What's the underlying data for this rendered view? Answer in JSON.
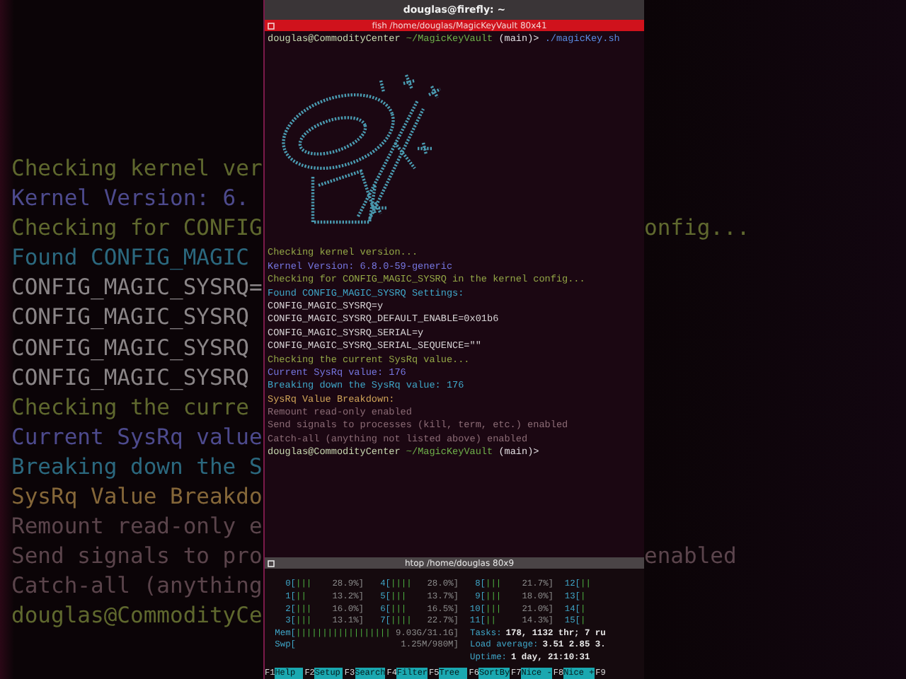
{
  "background_lines": [
    {
      "kind": "check",
      "left": "Checking kernel ver"
    },
    {
      "kind": "version",
      "left": "Kernel Version: 6."
    },
    {
      "kind": "check",
      "left": "Checking for CONFIG",
      "right": "onfig..."
    },
    {
      "kind": "found",
      "left": "Found CONFIG_MAGIC"
    },
    {
      "kind": "plain",
      "left": "CONFIG_MAGIC_SYSRQ="
    },
    {
      "kind": "plain",
      "left": "CONFIG_MAGIC_SYSRQ"
    },
    {
      "kind": "plain",
      "left": "CONFIG_MAGIC_SYSRQ"
    },
    {
      "kind": "plain",
      "left": "CONFIG_MAGIC_SYSRQ"
    },
    {
      "kind": "check",
      "left": "Checking the curre"
    },
    {
      "kind": "version",
      "left": "Current SysRq value"
    },
    {
      "kind": "found",
      "left": "Breaking down the S"
    },
    {
      "kind": "heading",
      "left": "SysRq Value Breakdo"
    },
    {
      "kind": "dim",
      "left": "Remount read-only e"
    },
    {
      "kind": "dim",
      "left": "Send signals to pro",
      "right": "enabled"
    },
    {
      "kind": "dim",
      "left": "Catch-all (anything"
    },
    {
      "kind": "check",
      "left": "douglas@CommodityCe"
    }
  ],
  "window": {
    "title": "douglas@firefly: ~"
  },
  "terminal": {
    "tab_title": "fish /home/douglas/MagicKeyVault 80x41",
    "command_prompt": {
      "user": "douglas@CommodityCenter",
      "path": "~/MagicKeyVault",
      "branch": "(main)>",
      "command": "./magicKey.sh"
    },
    "lines": [
      {
        "kind": "check",
        "text": "Checking kernel version..."
      },
      {
        "kind": "version",
        "text": "Kernel Version: 6.8.0-59-generic"
      },
      {
        "kind": "check",
        "text": "Checking for CONFIG_MAGIC_SYSRQ in the kernel config..."
      },
      {
        "kind": "found",
        "text": "Found CONFIG_MAGIC_SYSRQ Settings:"
      },
      {
        "kind": "plain",
        "text": "CONFIG_MAGIC_SYSRQ=y"
      },
      {
        "kind": "plain",
        "text": "CONFIG_MAGIC_SYSRQ_DEFAULT_ENABLE=0x01b6"
      },
      {
        "kind": "plain",
        "text": "CONFIG_MAGIC_SYSRQ_SERIAL=y"
      },
      {
        "kind": "plain",
        "text": "CONFIG_MAGIC_SYSRQ_SERIAL_SEQUENCE=\"\""
      },
      {
        "kind": "check",
        "text": "Checking the current SysRq value..."
      },
      {
        "kind": "version",
        "text": "Current SysRq value: 176"
      },
      {
        "kind": "found",
        "text": "Breaking down the SysRq value: 176"
      },
      {
        "kind": "heading",
        "text": "SysRq Value Breakdown:"
      },
      {
        "kind": "dim",
        "text": "Remount read-only enabled"
      },
      {
        "kind": "dim",
        "text": "Send signals to processes (kill, term, etc.) enabled"
      },
      {
        "kind": "dim",
        "text": "Catch-all (anything not listed above) enabled"
      }
    ],
    "end_prompt": {
      "user": "douglas@CommodityCenter",
      "path": "~/MagicKeyVault",
      "branch": "(main)>"
    }
  },
  "htop": {
    "title": "htop /home/douglas 80x9",
    "cpu_rows": [
      [
        {
          "label": "0[",
          "bars": "|||",
          "value": "28.9%]"
        },
        {
          "label": "4[",
          "bars": "||||",
          "value": "28.0%]"
        },
        {
          "label": "8[",
          "bars": "|||",
          "value": "21.7%]"
        },
        {
          "label": "12[",
          "bars": "||"
        }
      ],
      [
        {
          "label": "1[",
          "bars": "||",
          "value": "13.2%]"
        },
        {
          "label": "5[",
          "bars": "|||",
          "value": "13.7%]"
        },
        {
          "label": "9[",
          "bars": "|||",
          "value": "18.0%]"
        },
        {
          "label": "13[",
          "bars": "|"
        }
      ],
      [
        {
          "label": "2[",
          "bars": "|||",
          "value": "16.0%]"
        },
        {
          "label": "6[",
          "bars": "|||",
          "value": "16.5%]"
        },
        {
          "label": "10[",
          "bars": "|||",
          "value": "21.0%]"
        },
        {
          "label": "14[",
          "bars": "|"
        }
      ],
      [
        {
          "label": "3[",
          "bars": "|||",
          "value": "13.1%]"
        },
        {
          "label": "7[",
          "bars": "||||",
          "value": "22.7%]"
        },
        {
          "label": "11[",
          "bars": "||",
          "value": "14.3%]"
        },
        {
          "label": "15[",
          "bars": "|"
        }
      ]
    ],
    "memory": [
      {
        "label": "Mem[",
        "bars": "||||||||||||||||||",
        "value": "9.03G/31.1G]"
      },
      {
        "label": "Swp[",
        "value": "1.25M/980M]"
      }
    ],
    "stats": [
      {
        "label": "Tasks:",
        "value": "178, 1132 thr; 7 ru"
      },
      {
        "label": "Load average:",
        "value": "3.51 2.85 3."
      },
      {
        "label": "Uptime:",
        "value": "1 day, 21:10:31"
      }
    ],
    "function_keys": [
      {
        "key": "F1",
        "label": "Help"
      },
      {
        "key": "F2",
        "label": "Setup"
      },
      {
        "key": "F3",
        "label": "Search"
      },
      {
        "key": "F4",
        "label": "Filter"
      },
      {
        "key": "F5",
        "label": "Tree"
      },
      {
        "key": "F6",
        "label": "SortBy"
      },
      {
        "key": "F7",
        "label": "Nice -"
      },
      {
        "key": "F8",
        "label": "Nice +"
      },
      {
        "key": "F9"
      }
    ]
  }
}
